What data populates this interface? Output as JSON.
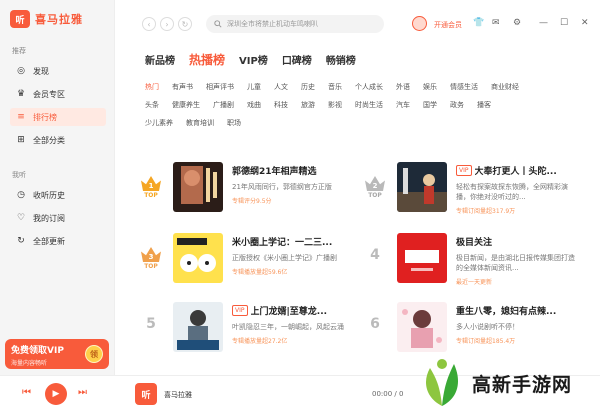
{
  "app": {
    "logo_mark": "听",
    "name": "喜马拉雅"
  },
  "sidebar": {
    "section_recommend": "推荐",
    "items_top": [
      {
        "label": "发现",
        "icon": "compass-icon",
        "glyph": "◎"
      },
      {
        "label": "会员专区",
        "icon": "vip-icon",
        "glyph": "♛"
      },
      {
        "label": "排行榜",
        "icon": "rank-icon",
        "glyph": "≡",
        "active": true
      },
      {
        "label": "全部分类",
        "icon": "grid-icon",
        "glyph": "⊞"
      }
    ],
    "section_mine": "我听",
    "items_mine": [
      {
        "label": "收听历史",
        "icon": "history-icon",
        "glyph": "◷"
      },
      {
        "label": "我的订阅",
        "icon": "heart-icon",
        "glyph": "♡"
      },
      {
        "label": "全部更新",
        "icon": "refresh-icon",
        "glyph": "↻"
      }
    ],
    "vip_banner": {
      "title": "免费领取VIP",
      "subtitle": "海量内容畅听",
      "coin": "领"
    }
  },
  "topbar": {
    "search_placeholder": "深圳全市将禁止机动车鸣喇叭",
    "open_vip": "开通会员"
  },
  "rank_tabs": [
    {
      "label": "新品榜"
    },
    {
      "label": "热播榜",
      "active": true
    },
    {
      "label": "VIP榜"
    },
    {
      "label": "口碑榜"
    },
    {
      "label": "畅销榜"
    }
  ],
  "categories": [
    [
      "热门",
      "有声书",
      "相声评书",
      "儿童",
      "人文",
      "历史",
      "音乐",
      "个人成长",
      "外语",
      "娱乐",
      "情感生活",
      "商业财经"
    ],
    [
      "头条",
      "健康养生",
      "广播剧",
      "戏曲",
      "科技",
      "旅游",
      "影视",
      "时尚生活",
      "汽车",
      "国学",
      "政务",
      "播客"
    ],
    [
      "少儿素养",
      "教育培训",
      "职场"
    ]
  ],
  "active_category": "热门",
  "rank_items": [
    {
      "rank": "1",
      "top_label": "TOP",
      "title": "郭德纲21年相声精选",
      "vip": false,
      "desc": "21年风雨同行，郭德纲官方正版",
      "play": "专辑评分9.5分"
    },
    {
      "rank": "2",
      "top_label": "TOP",
      "title": "大奉打更人丨头陀...",
      "vip": true,
      "vip_label": "VIP",
      "desc": "轻松有探案故探东恢腾，全网精彩演播，你绝对没听过的...",
      "play": "专辑订阅量超317.9万"
    },
    {
      "rank": "3",
      "top_label": "TOP",
      "title": "米小圈上学记：一二三...",
      "vip": false,
      "desc": "正版授权《米小圈上学记》广播剧",
      "play": "专辑播放量超59.6亿"
    },
    {
      "rank": "4",
      "title": "极目关注",
      "vip": false,
      "desc": "极目新闻，是由湖北日报传媒集团打造的全媒体新闻资讯...",
      "play": "最近一天更新"
    },
    {
      "rank": "5",
      "title": "上门龙婿|至尊龙...",
      "vip": true,
      "vip_label": "VIP",
      "desc": "叶凯隐忍三年，一朝崛起，风起云涌",
      "play": "专辑播放量超27.2亿"
    },
    {
      "rank": "6",
      "title": "重生八零，媳妇有点辣...",
      "vip": false,
      "desc": "多人小说剧听不停！",
      "play": "专辑订阅量超185.4万"
    }
  ],
  "player": {
    "now_logo": "听",
    "now_title": "喜马拉雅",
    "time": "00:00 / 0"
  },
  "watermark": {
    "text": "高新手游网"
  },
  "colors": {
    "accent": "#f85b3b",
    "gold": "#f5a623",
    "silver": "#b9b9b9"
  }
}
